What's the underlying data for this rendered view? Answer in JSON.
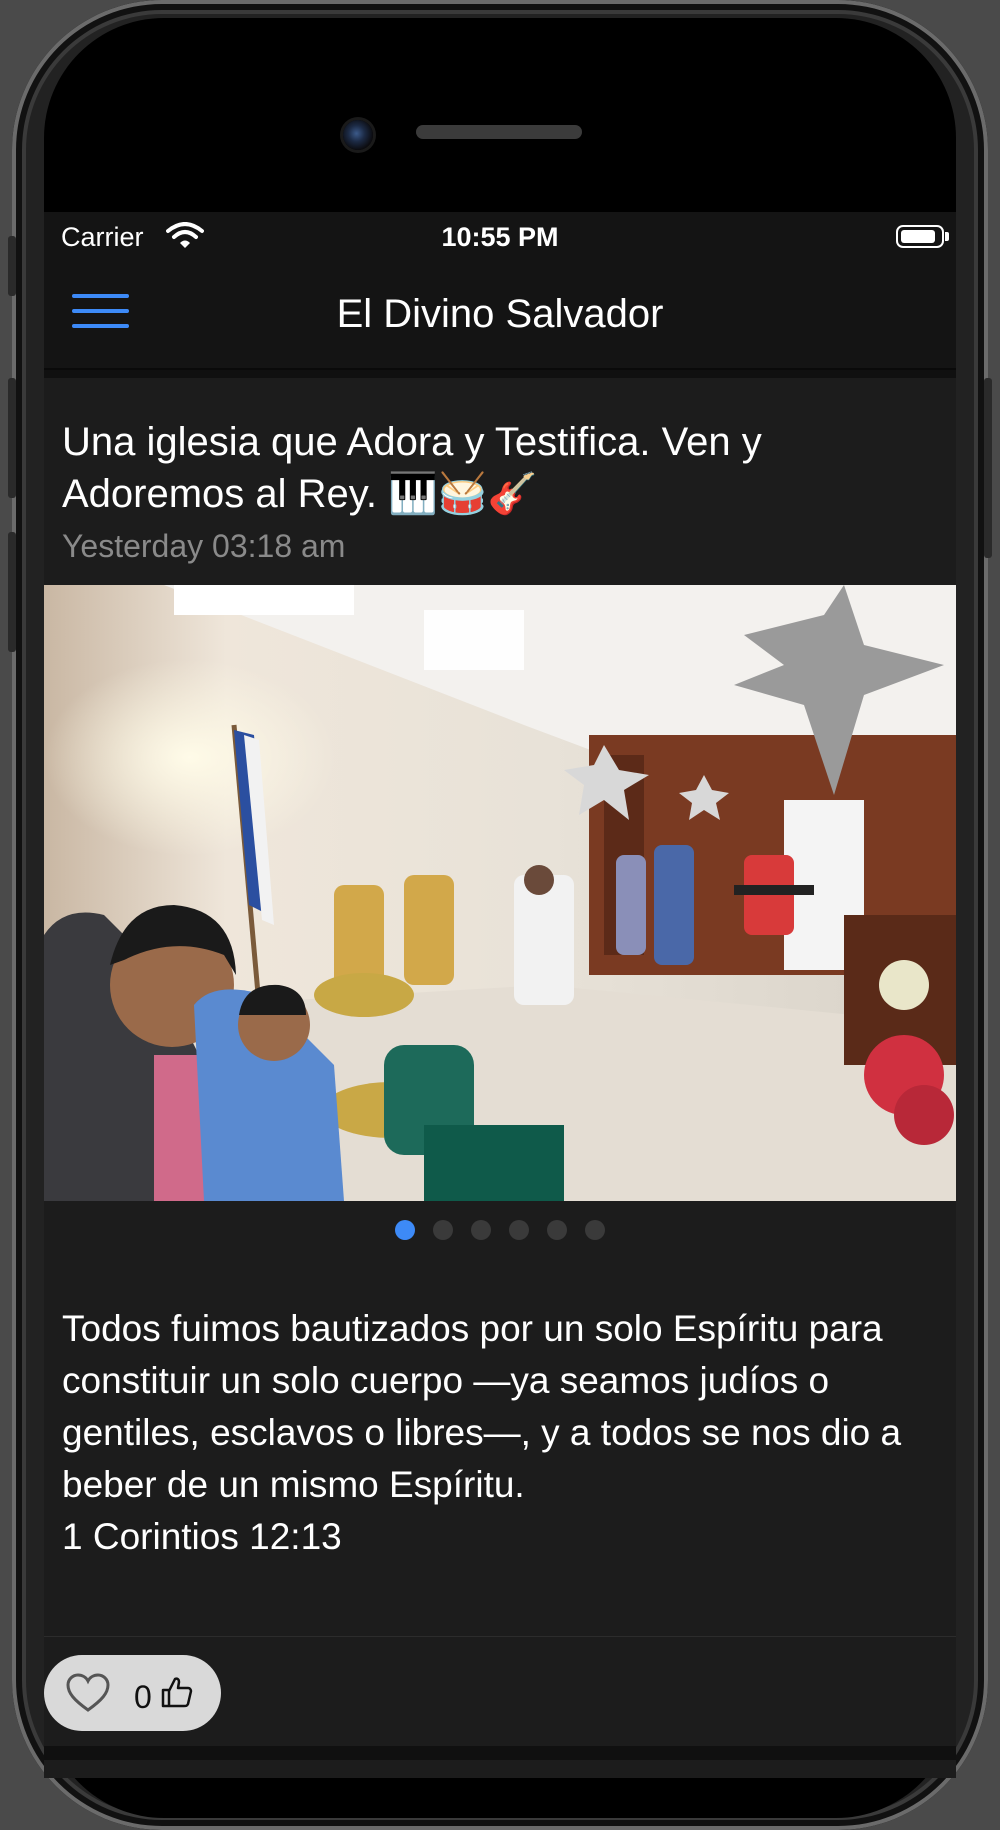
{
  "status_bar": {
    "carrier": "Carrier",
    "time": "10:55 PM"
  },
  "nav": {
    "title": "El Divino Salvador",
    "accent_color": "#3d8af7"
  },
  "post": {
    "title": "Una iglesia que Adora y Testifica. Ven y Adoremos al Rey. 🎹🥁🎸",
    "timestamp": "Yesterday 03:18 am",
    "carousel": {
      "total": 6,
      "active_index": 0
    },
    "body": "Todos fuimos bautizados por un solo Espíritu para constituir un solo cuerpo —ya seamos judíos o gentiles, esclavos o libres—, y a todos se nos dio a beber de un mismo Espíritu.",
    "reference": "1 Corintios 12:13",
    "likes": "0"
  },
  "icons": {
    "menu": "hamburger-menu-icon",
    "wifi": "wifi-icon",
    "battery": "battery-icon",
    "like": "heart-icon",
    "thumb": "thumbs-up-icon"
  },
  "colors": {
    "background": "#101010",
    "card": "#1c1c1c",
    "text": "#ffffff",
    "secondary_text": "#8a8a8a",
    "like_pill": "#d9d9d9"
  }
}
